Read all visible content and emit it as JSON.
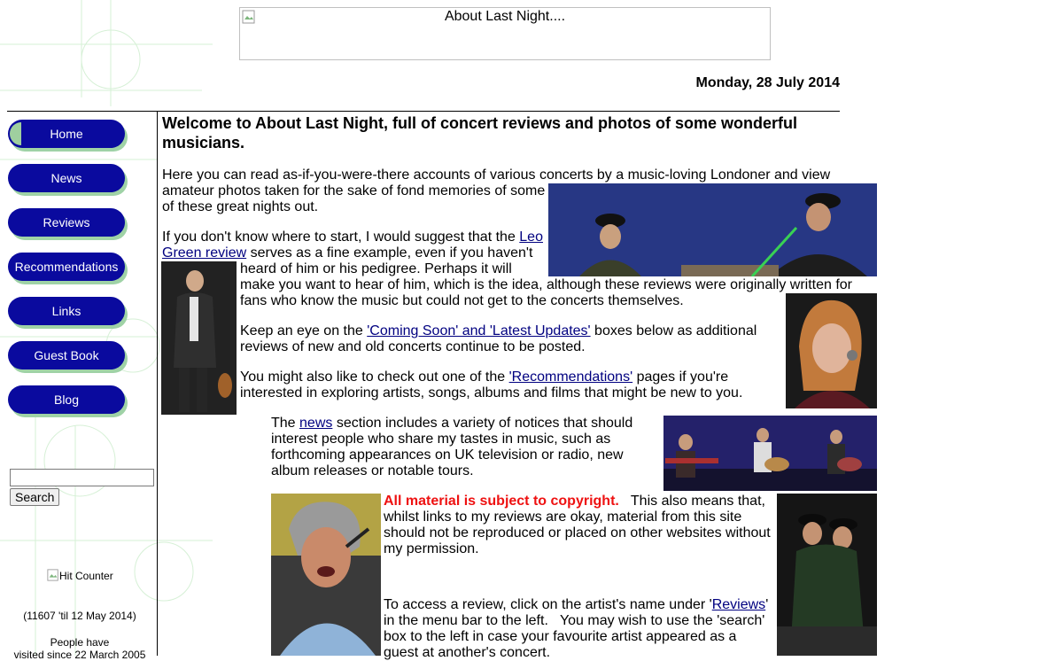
{
  "banner": {
    "alt_text": "About Last Night...."
  },
  "date": "Monday, 28 July 2014",
  "nav": {
    "items": [
      {
        "label": "Home"
      },
      {
        "label": "News"
      },
      {
        "label": "Reviews"
      },
      {
        "label": "Recommendations"
      },
      {
        "label": "Links"
      },
      {
        "label": "Guest Book"
      },
      {
        "label": "Blog"
      }
    ]
  },
  "search": {
    "value": "",
    "button_label": "Search"
  },
  "counter": {
    "alt_text": "Hit Counter",
    "note": "(11607 'til 12 May 2014)",
    "line1": "People have",
    "line2": "visited since 22 March 2005"
  },
  "main": {
    "headline": "Welcome to About Last Night, full of concert reviews and photos of some wonderful musicians.",
    "intro": {
      "line1": "Here you can read as-if-you-were-there accounts of various concerts by a music-loving Londoner and view",
      "line2": "amateur photos taken for the sake of fond memories of some",
      "line3": "of these great nights out."
    },
    "start": {
      "line1_pre": "If you don't know where to start, I would suggest that the ",
      "link_part1": "Leo",
      "link_part2": "Green review",
      "line2_post": " serves as a fine example, even if you haven't",
      "line3": "heard of him or his pedigree.  Perhaps it will",
      "line4": "make you want to hear of  him, which is the idea, although these reviews were originally written for",
      "line5": "fans who know the music but could not get to the concerts themselves."
    },
    "keep": {
      "line1_pre": "Keep an eye on the ",
      "link": "'Coming Soon' and 'Latest Updates'",
      "line1_post": " boxes below as additional",
      "line2": "reviews of new and old concerts continue to be posted."
    },
    "recs": {
      "line1_pre": "You might also like to check out one of the ",
      "link": "'Recommendations'",
      "line1_post": " pages if you're",
      "line2": "interested in exploring artists, songs, albums and films that might be new to you."
    },
    "news": {
      "line1_pre": "The ",
      "link": "news",
      "line1_post": " section includes a variety of notices that should",
      "line2": "interest people who share my tastes in music, such as",
      "line3": "forthcoming appearances on UK television or radio, new",
      "line4": "album releases or notable tours."
    },
    "copyright": {
      "bold": "All material is subject to copyright.",
      "line1_post": "   This also means that,",
      "line2": "whilst links to my reviews are okay, material from this site",
      "line3": "should not be reproduced or placed on other websites without",
      "line4": "my permission."
    },
    "access": {
      "line1_pre": "To access a review, click on the artist's name under '",
      "link": "Reviews",
      "line1_post": "'",
      "line2": "in the menu bar to the left.   You may wish to use the 'search'",
      "line3": "box to the left in case your favourite artist appeared as a",
      "line4": "guest at another's concert."
    }
  }
}
